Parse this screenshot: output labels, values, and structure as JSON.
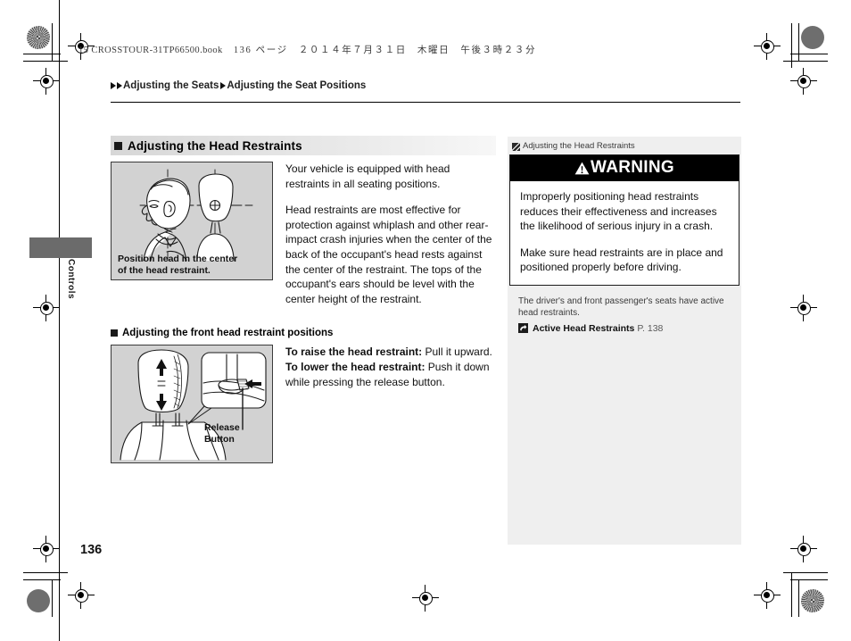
{
  "running_head": {
    "book_file": "15 CROSSTOUR-31TP66500.book",
    "page_label": "136 ページ",
    "date": "２０１４年７月３１日",
    "weekday": "木曜日",
    "time": "午後３時２３分"
  },
  "breadcrumb": {
    "level1": "Adjusting the Seats",
    "level2": "Adjusting the Seat Positions"
  },
  "thumb_tab": {
    "label": "Controls"
  },
  "main": {
    "section_heading": "Adjusting the Head Restraints",
    "figure1": {
      "caption_line1": "Position head in the center",
      "caption_line2": "of the head restraint."
    },
    "paragraphs": [
      "Your vehicle is equipped with head restraints in all seating positions.",
      "Head restraints are most effective for protection against whiplash and other rear-impact crash injuries when the center of the back of the occupant's head rests against the center of the restraint. The tops of the occupant's ears should be level with the center height of the restraint."
    ],
    "sub_heading": "Adjusting the front head restraint positions",
    "figure2": {
      "label_line1": "Release",
      "label_line2": "Button"
    },
    "instructions": [
      {
        "bold": "To raise the head restraint:",
        "rest": " Pull it upward."
      },
      {
        "bold": "To lower the head restraint:",
        "rest": " Push it down while pressing the release button."
      }
    ]
  },
  "sidebar": {
    "header": "Adjusting the Head Restraints",
    "warning_title": "WARNING",
    "warning_paragraphs": [
      "Improperly positioning head restraints reduces their effectiveness and increases the likelihood of serious injury in a crash.",
      "Make sure head restraints are in place and positioned properly before driving."
    ],
    "note": "The driver's and front passenger's seats have active head restraints.",
    "xref_label": "Active Head Restraints",
    "xref_page": "P. 138"
  },
  "folio": {
    "page_number": "136"
  },
  "colors": {
    "figure_background": "#d2d2d2",
    "sidebar_background": "#efefef",
    "heading_bar": "#d7d7d7",
    "warning_bar": "#000000",
    "thumb_tab": "#6b6b6b"
  }
}
